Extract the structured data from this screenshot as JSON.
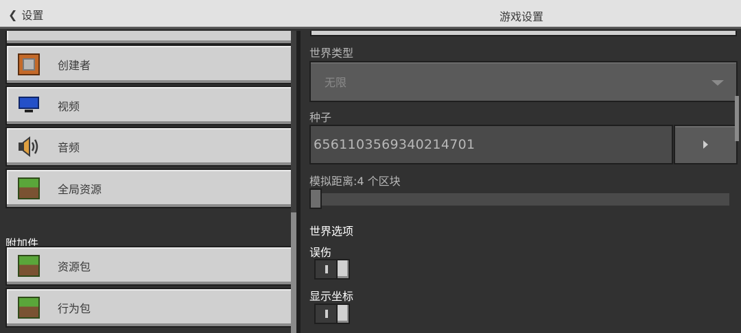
{
  "header": {
    "back_label": "设置",
    "title": "游戏设置"
  },
  "sidebar": {
    "items": [
      {
        "label": "创建者",
        "icon": "creator-icon"
      },
      {
        "label": "视频",
        "icon": "monitor-icon"
      },
      {
        "label": "音频",
        "icon": "speaker-icon"
      },
      {
        "label": "全局资源",
        "icon": "grass-block-icon"
      }
    ],
    "addons_title": "附加件",
    "addons": [
      {
        "label": "资源包",
        "icon": "grass-block-icon"
      },
      {
        "label": "行为包",
        "icon": "grass-block-icon"
      }
    ]
  },
  "main": {
    "world_type": {
      "label": "世界类型",
      "value": "无限"
    },
    "seed": {
      "label": "种子",
      "value": "6561103569340214701"
    },
    "simulation_distance": {
      "label": "模拟距离:4 个区块",
      "value": 4
    },
    "world_options": {
      "title": "世界选项",
      "friendly_fire": {
        "label": "误伤",
        "on": true
      },
      "show_coordinates": {
        "label": "显示坐标",
        "on": true
      }
    }
  }
}
